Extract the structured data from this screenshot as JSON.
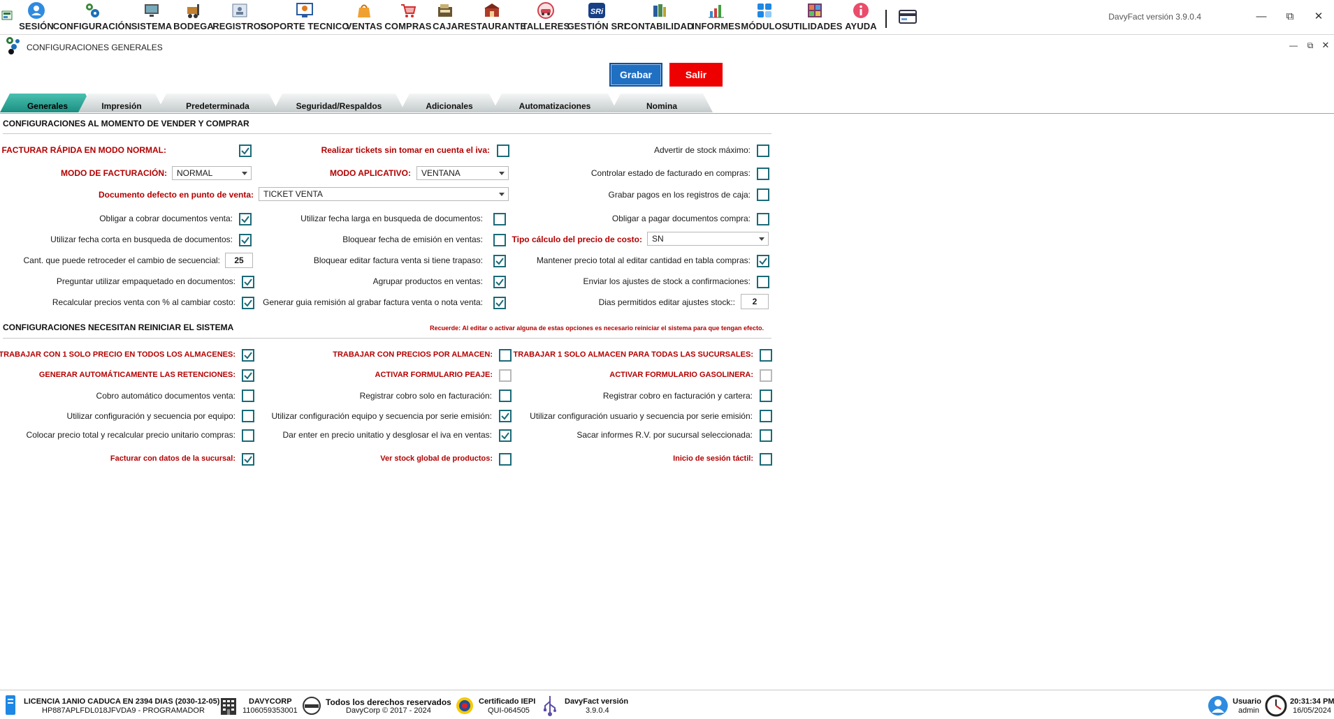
{
  "menu": {
    "items": [
      {
        "label": "SESIÓN",
        "icon": "user-icon"
      },
      {
        "label": "CONFIGURACIÓN",
        "icon": "gears-icon"
      },
      {
        "label": "SISTEMA",
        "icon": "monitor-icon"
      },
      {
        "label": "BODEGA",
        "icon": "forklift-icon"
      },
      {
        "label": "REGISTROS",
        "icon": "contact-card-icon"
      },
      {
        "label": "SOPORTE TECNICO",
        "icon": "support-icon"
      },
      {
        "label": "VENTAS",
        "icon": "shopping-bag-icon"
      },
      {
        "label": "COMPRAS",
        "icon": "cart-icon"
      },
      {
        "label": "CAJA",
        "icon": "cash-register-icon"
      },
      {
        "label": "RESTAURANTE",
        "icon": "restaurant-icon"
      },
      {
        "label": "TALLERES",
        "icon": "car-icon"
      },
      {
        "label": "GESTIÓN SRI",
        "icon": "sri-icon"
      },
      {
        "label": "CONTABILIDAD",
        "icon": "books-icon"
      },
      {
        "label": "INFORMES",
        "icon": "bar-chart-icon"
      },
      {
        "label": "MÓDULOS",
        "icon": "modules-icon"
      },
      {
        "label": "UTILIDADES",
        "icon": "grid-icon"
      },
      {
        "label": "AYUDA",
        "icon": "info-icon"
      }
    ],
    "app_version": "DavyFact versión 3.9.0.4"
  },
  "window": {
    "title": "CONFIGURACIONES GENERALES"
  },
  "actions": {
    "save": "Grabar",
    "exit": "Salir"
  },
  "tabs": [
    "Generales",
    "Impresión",
    "Predeterminada",
    "Seguridad/Respaldos",
    "Adicionales",
    "Automatizaciones",
    "Nomina"
  ],
  "section1": {
    "title": "CONFIGURACIONES AL MOMENTO DE VENDER Y COMPRAR",
    "facturar_rapida": "FACTURAR RÁPIDA EN MODO NORMAL:",
    "realizar_tickets": "Realizar tickets sin tomar en cuenta el iva:",
    "advertir_stock": "Advertir de stock máximo:",
    "modo_facturacion": "MODO DE FACTURACIÓN:",
    "modo_facturacion_value": "NORMAL",
    "modo_aplicativo": "MODO APLICATIVO:",
    "modo_aplicativo_value": "VENTANA",
    "controlar_estado": "Controlar estado de facturado en compras:",
    "documento_defecto": "Documento defecto en punto de venta:",
    "documento_defecto_value": "TICKET VENTA",
    "grabar_pagos": "Grabar pagos en los registros de caja:",
    "obligar_cobrar": "Obligar a cobrar documentos venta:",
    "fecha_larga": "Utilizar fecha larga en busqueda de documentos:",
    "obligar_pagar": "Obligar a pagar documentos compra:",
    "fecha_corta": "Utilizar fecha corta en busqueda de documentos:",
    "bloquear_fecha": "Bloquear fecha de emisión en ventas:",
    "tipo_calculo": "Tipo cálculo del precio de costo:",
    "tipo_calculo_value": "SN",
    "cant_retroceder": "Cant. que puede retroceder el cambio de secuencial:",
    "cant_retroceder_value": "25",
    "bloquear_editar": "Bloquear editar factura venta si tiene trapaso:",
    "mantener_precio": "Mantener precio total al editar cantidad en tabla compras:",
    "preguntar_empaquetado": "Preguntar utilizar empaquetado en documentos:",
    "agrupar_productos": "Agrupar productos en ventas:",
    "enviar_ajustes": "Enviar los ajustes de stock a confirmaciones:",
    "recalcular_precios": "Recalcular precios venta con % al cambiar costo:",
    "generar_guia": "Generar guia remisión al grabar factura venta o nota venta:",
    "dias_permitidos": "Dias permitidos editar ajustes stock::",
    "dias_permitidos_value": "2"
  },
  "section2": {
    "title": "CONFIGURACIONES NECESITAN REINICIAR EL SISTEMA",
    "notice": "Recuerde: Al editar o activar alguna de estas opciones es necesario reiniciar el sistema para que tengan efecto.",
    "un_precio": "TRABAJAR CON 1 SOLO PRECIO EN TODOS LOS ALMACENES:",
    "precios_almacen": "TRABAJAR CON PRECIOS POR ALMACEN:",
    "un_almacen": "TRABAJAR 1 SOLO ALMACEN PARA TODAS LAS SUCURSALES:",
    "generar_retenciones": "GENERAR AUTOMÁTICAMENTE LAS RETENCIONES:",
    "form_peaje": "ACTIVAR FORMULARIO PEAJE:",
    "form_gasolinera": "ACTIVAR FORMULARIO GASOLINERA:",
    "cobro_automatico": "Cobro automático documentos venta:",
    "cobro_facturacion": "Registrar cobro solo en facturación:",
    "cobro_cartera": "Registrar cobro en facturación y cartera:",
    "config_equipo": "Utilizar configuración y secuencia por equipo:",
    "config_serie": "Utilizar configuración equipo y secuencia por serie emisión:",
    "config_usuario": "Utilizar configuración usuario y secuencia por serie emisión:",
    "colocar_precio": "Colocar precio total y recalcular precio unitario compras:",
    "dar_enter": "Dar enter en precio unitatio y desglosar el iva en ventas:",
    "sacar_informes": "Sacar informes R.V. por sucursal seleccionada:",
    "facturar_sucursal": "Facturar con datos de la sucursal:",
    "stock_global": "Ver stock global de productos:",
    "sesion_tactil": "Inicio de sesión táctil:"
  },
  "status": {
    "licencia": "LICENCIA 1ANIO CADUCA EN 2394 DIAS (2030-12-05)",
    "licencia_code": "HP887APLFDL018JFVDA9 - PROGRAMADOR",
    "company": "DAVYCORP",
    "company_id": "1106059353001",
    "rights": "Todos los derechos reservados",
    "rights_sub": "DavyCorp © 2017 - 2024",
    "cert": "Certificado IEPI",
    "cert_code": "QUI-064505",
    "version_label": "DavyFact versión",
    "version": "3.9.0.4",
    "user_label": "Usuario",
    "user": "admin",
    "time": "20:31:34 PM",
    "date": "16/05/2024"
  }
}
